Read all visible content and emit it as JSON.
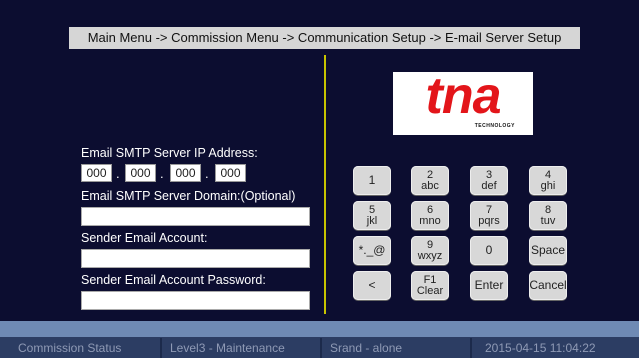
{
  "breadcrumb": "Main Menu -> Commission Menu -> Communication Setup -> E-mail Server Setup",
  "logo": {
    "text": "tna",
    "sub": "TECHNOLOGY"
  },
  "form": {
    "ip_label": "Email SMTP Server IP Address:",
    "ip": [
      "000",
      "000",
      "000",
      "000"
    ],
    "ip_sep": ".",
    "domain_label": "Email SMTP Server Domain:(Optional)",
    "domain_value": "",
    "sender_label": "Sender Email Account:",
    "sender_value": "",
    "password_label": "Sender Email Account Password:",
    "password_value": ""
  },
  "keypad": {
    "k1": {
      "top": "1",
      "bottom": ""
    },
    "k2": {
      "top": "2",
      "bottom": "abc"
    },
    "k3": {
      "top": "3",
      "bottom": "def"
    },
    "k4": {
      "top": "4",
      "bottom": "ghi"
    },
    "k5": {
      "top": "5",
      "bottom": "jkl"
    },
    "k6": {
      "top": "6",
      "bottom": "mno"
    },
    "k7": {
      "top": "7",
      "bottom": "pqrs"
    },
    "k8": {
      "top": "8",
      "bottom": "tuv"
    },
    "ksym": {
      "top": "*._@",
      "bottom": ""
    },
    "k9": {
      "top": "9",
      "bottom": "wxyz"
    },
    "k0": {
      "top": "0",
      "bottom": ""
    },
    "kspace": {
      "top": "Space",
      "bottom": ""
    },
    "kback": {
      "top": "<",
      "bottom": ""
    },
    "kclear": {
      "top": "F1",
      "bottom": "Clear"
    },
    "kenter": {
      "top": "Enter",
      "bottom": ""
    },
    "kcancel": {
      "top": "Cancel",
      "bottom": ""
    }
  },
  "status": {
    "section": "Commission Status",
    "level": "Level3 - Maintenance",
    "mode": "Srand - alone",
    "datetime": "2015-04-15 11:04:22"
  },
  "colors": {
    "logo_red": "#e3151a",
    "divider": "#c8c400",
    "background": "#0c0d30",
    "bluebar": "#6f8ab4",
    "statusbar": "#2c3d63"
  }
}
